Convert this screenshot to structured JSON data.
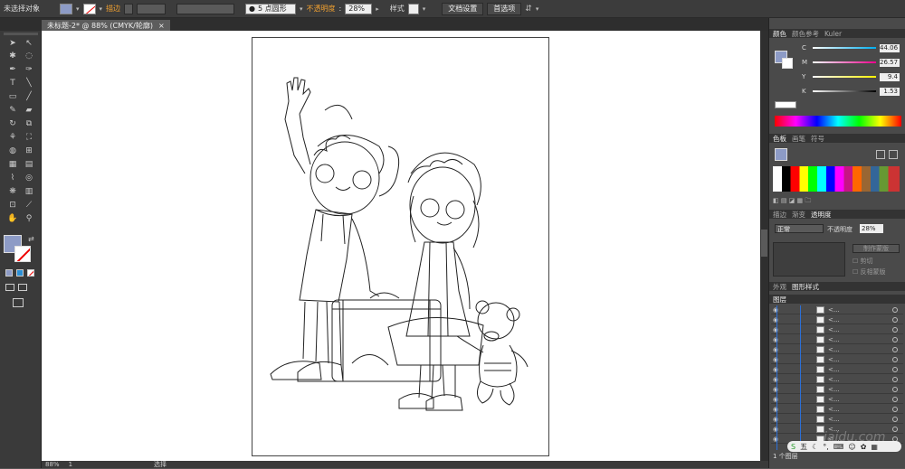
{
  "control_bar": {
    "selection_label": "未选择对象",
    "stroke_label": "描边",
    "brush_value": "5 点圆形",
    "opacity_label": "不透明度",
    "opacity_value": "28%",
    "style_label": "样式",
    "doc_settings_button": "文档设置",
    "preferences_button": "首选项"
  },
  "document_tab": {
    "title": "未标题-2* @ 88% (CMYK/轮廓)",
    "close": "×"
  },
  "color_panel": {
    "tabs": [
      "颜色",
      "颜色参考",
      "Kuler"
    ],
    "channels": [
      {
        "label": "C",
        "value": "44.06",
        "color": "#00aeef"
      },
      {
        "label": "M",
        "value": "26.57",
        "color": "#ec008c"
      },
      {
        "label": "Y",
        "value": "9.4",
        "color": "#fff200"
      },
      {
        "label": "K",
        "value": "1.53",
        "color": "#000000"
      }
    ],
    "fill_color": "#8d9bc6"
  },
  "swatches_panel": {
    "tabs": [
      "色板",
      "画笔",
      "符号"
    ]
  },
  "stroke_panel": {
    "tabs": [
      "描边",
      "渐变",
      "透明度"
    ],
    "blend_mode": "正常",
    "opacity_label": "不透明度",
    "opacity_value": "28%",
    "make_mask_button": "制作蒙版",
    "clip_label": "剪切",
    "invert_label": "反相蒙版"
  },
  "appearance_panel": {
    "tabs": [
      "外观",
      "图形样式"
    ]
  },
  "layers_panel": {
    "title": "图层",
    "footer": "1 个图层",
    "row_label": "<...",
    "row_count": 14
  },
  "status_bar": {
    "zoom": "88%",
    "page": "1",
    "tool": "选择"
  },
  "watermark": {
    "text": "jaidu.com",
    "ime_label": "五"
  }
}
